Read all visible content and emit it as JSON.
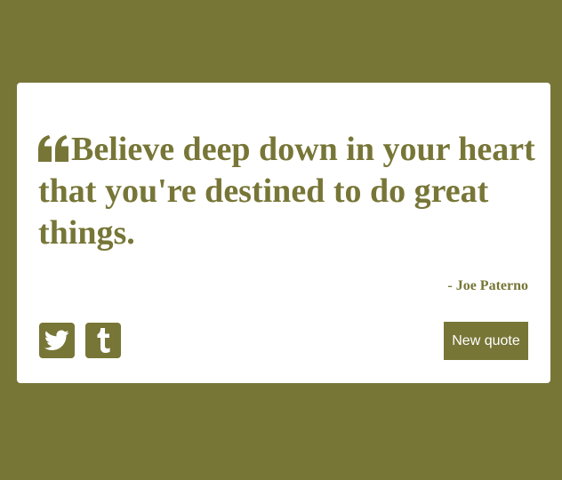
{
  "quote": {
    "text": "Believe deep down in your heart that you're destined to do great things.",
    "author": "- Joe Paterno",
    "quote_icon": "quote-left-icon"
  },
  "actions": {
    "new_quote_label": "New quote",
    "share_twitter_icon": "twitter-icon",
    "share_tumblr_icon": "tumblr-icon"
  },
  "colors": {
    "background": "#777637",
    "card": "#ffffff",
    "accent": "#777637"
  }
}
